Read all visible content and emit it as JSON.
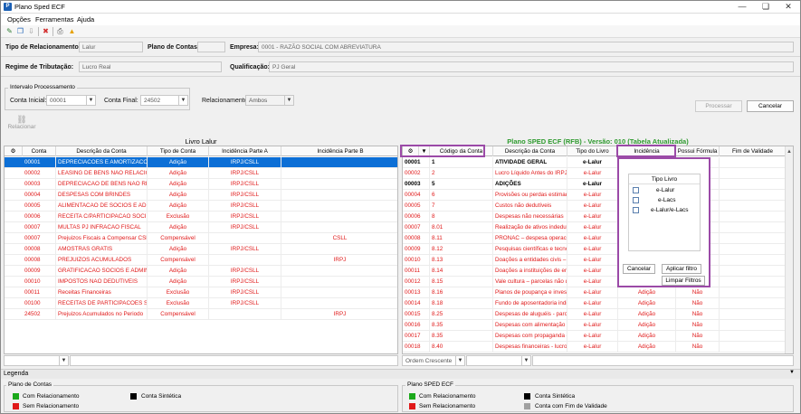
{
  "window": {
    "title": "Plano Sped ECF"
  },
  "menu": [
    "Opções",
    "Ferramentas",
    "Ajuda"
  ],
  "header": {
    "tipo_relacionamento_label": "Tipo de Relacionamento:",
    "tipo_relacionamento_value": "Lalur",
    "plano_contas_label": "Plano de Contas:",
    "plano_contas_value": "",
    "empresa_label": "Empresa:",
    "empresa_value": "0001 - RAZÃO SOCIAL COM ABREVIATURA",
    "regime_label": "Regime de Tributação:",
    "regime_value": "Lucro Real",
    "qualificacao_label": "Qualificação:",
    "qualificacao_value": "PJ Geral"
  },
  "intervalo": {
    "title": "Intervalo Processamento",
    "conta_inicial_label": "Conta Inicial:",
    "conta_inicial_value": "00001",
    "conta_final_label": "Conta Final:",
    "conta_final_value": "24502",
    "relacionamento_label": "Relacionamento:",
    "relacionamento_value": "Ambos"
  },
  "buttons": {
    "processar": "Processar",
    "cancelar": "Cancelar",
    "relacionar": "Relacionar"
  },
  "lalur": {
    "title": "Livro Lalur",
    "columns": [
      "Conta",
      "Descrição da Conta",
      "Tipo de Conta",
      "Incidência Parte A",
      "Incidência Parte B"
    ],
    "rows": [
      [
        "00001",
        "DEPRECIACOES E AMORTIZACOES",
        "Adição",
        "IRPJ/CSLL",
        ""
      ],
      [
        "00002",
        "LEASING DE BENS NAO RELACIONA",
        "Adição",
        "IRPJ/CSLL",
        ""
      ],
      [
        "00003",
        "DEPRECIACAO DE BENS NAO RELAC",
        "Adição",
        "IRPJ/CSLL",
        ""
      ],
      [
        "00004",
        "DESPESAS COM BRINDES",
        "Adição",
        "IRPJ/CSLL",
        ""
      ],
      [
        "00005",
        "ALIMENTACAO DE SOCIOS E ADMIN",
        "Adição",
        "IRPJ/CSLL",
        ""
      ],
      [
        "00006",
        "RECEITA C/PARTICIPACAO SOCIET",
        "Exclusão",
        "IRPJ/CSLL",
        ""
      ],
      [
        "00007",
        "MULTAS PJ INFRACAO FISCAL",
        "Adição",
        "IRPJ/CSLL",
        ""
      ],
      [
        "00007",
        "Prejuizos Fiscais a Compensar CSLL",
        "Compensável",
        "",
        "CSLL"
      ],
      [
        "00008",
        "AMOSTRAS GRATIS",
        "Adição",
        "IRPJ/CSLL",
        ""
      ],
      [
        "00008",
        "PREJUIZOS ACUMULADOS",
        "Compensável",
        "",
        "IRPJ"
      ],
      [
        "00009",
        "GRATIFICACAO SOCIOS E ADMINIS",
        "Adição",
        "IRPJ/CSLL",
        ""
      ],
      [
        "00010",
        "IMPOSTOS NAO DEDUTIVEIS",
        "Adição",
        "IRPJ/CSLL",
        ""
      ],
      [
        "00011",
        "Receitas Financeiras",
        "Exclusão",
        "IRPJ/CSLL",
        ""
      ],
      [
        "00100",
        "RECEITAS DE PARTICIPACOES SOC",
        "Exclusão",
        "IRPJ/CSLL",
        ""
      ],
      [
        "24502",
        "Prejuizos Acumulados no Periodo",
        "Compensável",
        "",
        "IRPJ"
      ]
    ]
  },
  "sped": {
    "title": "Plano SPED ECF (RFB) - Versão: 010 (Tabela Atualizada)",
    "columns": [
      "Código da Conta",
      "Descrição da Conta",
      "Tipo do Livro",
      "Incidência",
      "Possui Fórmula",
      "Fim de Validade"
    ],
    "rows": [
      [
        "00001",
        "1",
        "ATIVIDADE GERAL",
        "e-Lalur",
        "",
        "",
        "b"
      ],
      [
        "00002",
        "2",
        "Lucro Líquido Antes do IRPJ",
        "e-Lalur",
        "",
        "",
        "r"
      ],
      [
        "00003",
        "5",
        "ADIÇÕES",
        "e-Lalur",
        "",
        "",
        "b"
      ],
      [
        "00004",
        "6",
        "Provisões ou perdas estimadas",
        "e-Lalur",
        "",
        "",
        "r"
      ],
      [
        "00005",
        "7",
        "Custos não dedutíveis",
        "e-Lalur",
        "",
        "",
        "r"
      ],
      [
        "00006",
        "8",
        "Despesas não necessárias",
        "e-Lalur",
        "",
        "",
        "r"
      ],
      [
        "00007",
        "8.01",
        "Realização de ativos indedutíve",
        "e-Lalur",
        "",
        "",
        "r"
      ],
      [
        "00008",
        "8.11",
        "PRONAC – despesa operaciona",
        "e-Lalur",
        "",
        "",
        "r"
      ],
      [
        "00009",
        "8.12",
        "Pesquisas científicas e tecnoló",
        "e-Lalur",
        "",
        "",
        "r"
      ],
      [
        "00010",
        "8.13",
        "Doações a entidades civis – pa",
        "e-Lalur",
        "",
        "",
        "r"
      ],
      [
        "00011",
        "8.14",
        "Doações a instituições de ensin",
        "e-Lalur",
        "",
        "",
        "r"
      ],
      [
        "00012",
        "8.15",
        "Vale cultura – parcelas não de",
        "e-Lalur",
        "",
        "",
        "r"
      ],
      [
        "00013",
        "8.16",
        "Planos de poupança e investim",
        "e-Lalur",
        "Adição",
        "Não",
        "r"
      ],
      [
        "00014",
        "8.18",
        "Fundo de aposentadoria individ",
        "e-Lalur",
        "Adição",
        "Não",
        "r"
      ],
      [
        "00015",
        "8.25",
        "Despesas de aluguéis - parcela",
        "e-Lalur",
        "Adição",
        "Não",
        "r"
      ],
      [
        "00016",
        "8.35",
        "Despesas com alimentação de",
        "e-Lalur",
        "Adição",
        "Não",
        "r"
      ],
      [
        "00017",
        "8.35",
        "Despesas com propaganda – p",
        "e-Lalur",
        "Adição",
        "Não",
        "r"
      ],
      [
        "00018",
        "8.40",
        "Despesas financeiras - lucros e",
        "e-Lalur",
        "Adição",
        "Não",
        "r"
      ]
    ]
  },
  "filter_popup": {
    "header": "Tipo Livro",
    "options": [
      "e-Lalur",
      "e-Lacs",
      "e-Lalur/e-Lacs"
    ],
    "cancel": "Cancelar",
    "apply": "Aplicar filtro",
    "clear": "Limpar Filtros"
  },
  "bottom": {
    "order_value": "Ordem Crescente"
  },
  "legend": {
    "title": "Legenda",
    "left_title": "Plano de Contas",
    "right_title": "Plano SPED ECF",
    "items_left": [
      {
        "label": "Com Relacionamento",
        "color": "#1aa81a"
      },
      {
        "label": "Sem Relacionamento",
        "color": "#e01818"
      },
      {
        "label": "Conta Sintética",
        "color": "#000000"
      }
    ],
    "items_right": [
      {
        "label": "Com Relacionamento",
        "color": "#1aa81a"
      },
      {
        "label": "Sem Relacionamento",
        "color": "#e01818"
      },
      {
        "label": "Conta Sintética",
        "color": "#000000"
      },
      {
        "label": "Conta com Fim de Validade",
        "color": "#a0a0a0"
      }
    ]
  }
}
